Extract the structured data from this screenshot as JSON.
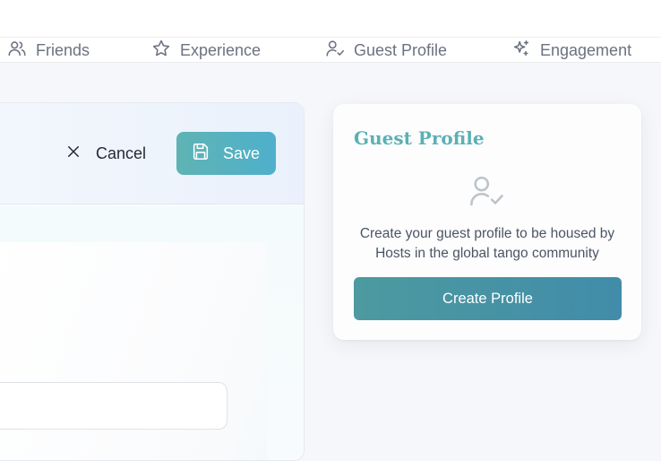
{
  "nav": {
    "items": [
      {
        "label": "Friends",
        "icon": "users-icon"
      },
      {
        "label": "Experience",
        "icon": "star-icon"
      },
      {
        "label": "Guest Profile",
        "icon": "user-check-icon"
      },
      {
        "label": "Engagement",
        "icon": "sparkles-icon"
      }
    ]
  },
  "editor": {
    "cancel_label": "Cancel",
    "save_label": "Save",
    "field_value": ""
  },
  "guest_card": {
    "title": "Guest Profile",
    "icon": "user-check-icon",
    "description": "Create your guest profile to be housed by Hosts in the global tango community",
    "button_label": "Create Profile"
  },
  "colors": {
    "accent_teal": "#5cb0b3",
    "button_gradient_start": "#4d9aa0",
    "button_gradient_end": "#418ca9",
    "save_gradient_start": "#5fb3b3",
    "save_gradient_end": "#4fb0cc"
  }
}
